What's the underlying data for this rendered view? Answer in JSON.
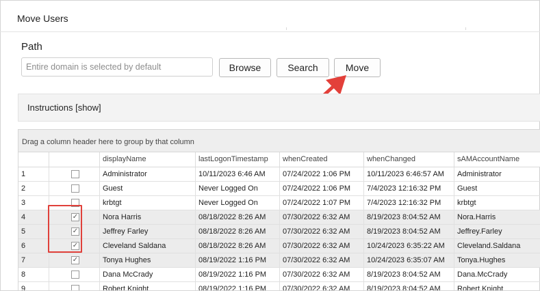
{
  "window": {
    "title": "Move Users"
  },
  "path": {
    "label": "Path",
    "placeholder": "Entire domain is selected by default",
    "value": ""
  },
  "buttons": {
    "browse": "Browse",
    "search": "Search",
    "move": "Move"
  },
  "instructions": {
    "label": "Instructions [show]"
  },
  "grid": {
    "group_hint": "Drag a column header here to group by that column",
    "columns": [
      "displayName",
      "lastLogonTimestamp",
      "whenCreated",
      "whenChanged",
      "sAMAccountName"
    ],
    "rows": [
      {
        "num": "1",
        "checked": false,
        "selected": false,
        "displayName": "Administrator",
        "lastLogonTimestamp": "10/11/2023 6:46 AM",
        "whenCreated": "07/24/2022 1:06 PM",
        "whenChanged": "10/11/2023 6:46:57 AM",
        "sAMAccountName": "Administrator"
      },
      {
        "num": "2",
        "checked": false,
        "selected": false,
        "displayName": "Guest",
        "lastLogonTimestamp": "Never Logged On",
        "whenCreated": "07/24/2022 1:06 PM",
        "whenChanged": "7/4/2023 12:16:32 PM",
        "sAMAccountName": "Guest"
      },
      {
        "num": "3",
        "checked": false,
        "selected": false,
        "displayName": "krbtgt",
        "lastLogonTimestamp": "Never Logged On",
        "whenCreated": "07/24/2022 1:07 PM",
        "whenChanged": "7/4/2023 12:16:32 PM",
        "sAMAccountName": "krbtgt"
      },
      {
        "num": "4",
        "checked": true,
        "selected": true,
        "displayName": "Nora Harris",
        "lastLogonTimestamp": "08/18/2022 8:26 AM",
        "whenCreated": "07/30/2022 6:32 AM",
        "whenChanged": "8/19/2023 8:04:52 AM",
        "sAMAccountName": "Nora.Harris"
      },
      {
        "num": "5",
        "checked": true,
        "selected": true,
        "displayName": "Jeffrey Farley",
        "lastLogonTimestamp": "08/18/2022 8:26 AM",
        "whenCreated": "07/30/2022 6:32 AM",
        "whenChanged": "8/19/2023 8:04:52 AM",
        "sAMAccountName": "Jeffrey.Farley"
      },
      {
        "num": "6",
        "checked": true,
        "selected": true,
        "displayName": "Cleveland Saldana",
        "lastLogonTimestamp": "08/18/2022 8:26 AM",
        "whenCreated": "07/30/2022 6:32 AM",
        "whenChanged": "10/24/2023 6:35:22 AM",
        "sAMAccountName": "Cleveland.Saldana"
      },
      {
        "num": "7",
        "checked": true,
        "selected": true,
        "displayName": "Tonya Hughes",
        "lastLogonTimestamp": "08/19/2022 1:16 PM",
        "whenCreated": "07/30/2022 6:32 AM",
        "whenChanged": "10/24/2023 6:35:07 AM",
        "sAMAccountName": "Tonya.Hughes"
      },
      {
        "num": "8",
        "checked": false,
        "selected": false,
        "displayName": "Dana McCrady",
        "lastLogonTimestamp": "08/19/2022 1:16 PM",
        "whenCreated": "07/30/2022 6:32 AM",
        "whenChanged": "8/19/2023 8:04:52 AM",
        "sAMAccountName": "Dana.McCrady"
      },
      {
        "num": "9",
        "checked": false,
        "selected": false,
        "displayName": "Robert Knight",
        "lastLogonTimestamp": "08/19/2022 1:16 PM",
        "whenCreated": "07/30/2022 6:32 AM",
        "whenChanged": "8/19/2023 8:04:52 AM",
        "sAMAccountName": "Robert.Knight"
      }
    ]
  },
  "colors": {
    "arrow": "#e3403a",
    "highlight": "#e0403a",
    "selected_row": "#ececec"
  }
}
